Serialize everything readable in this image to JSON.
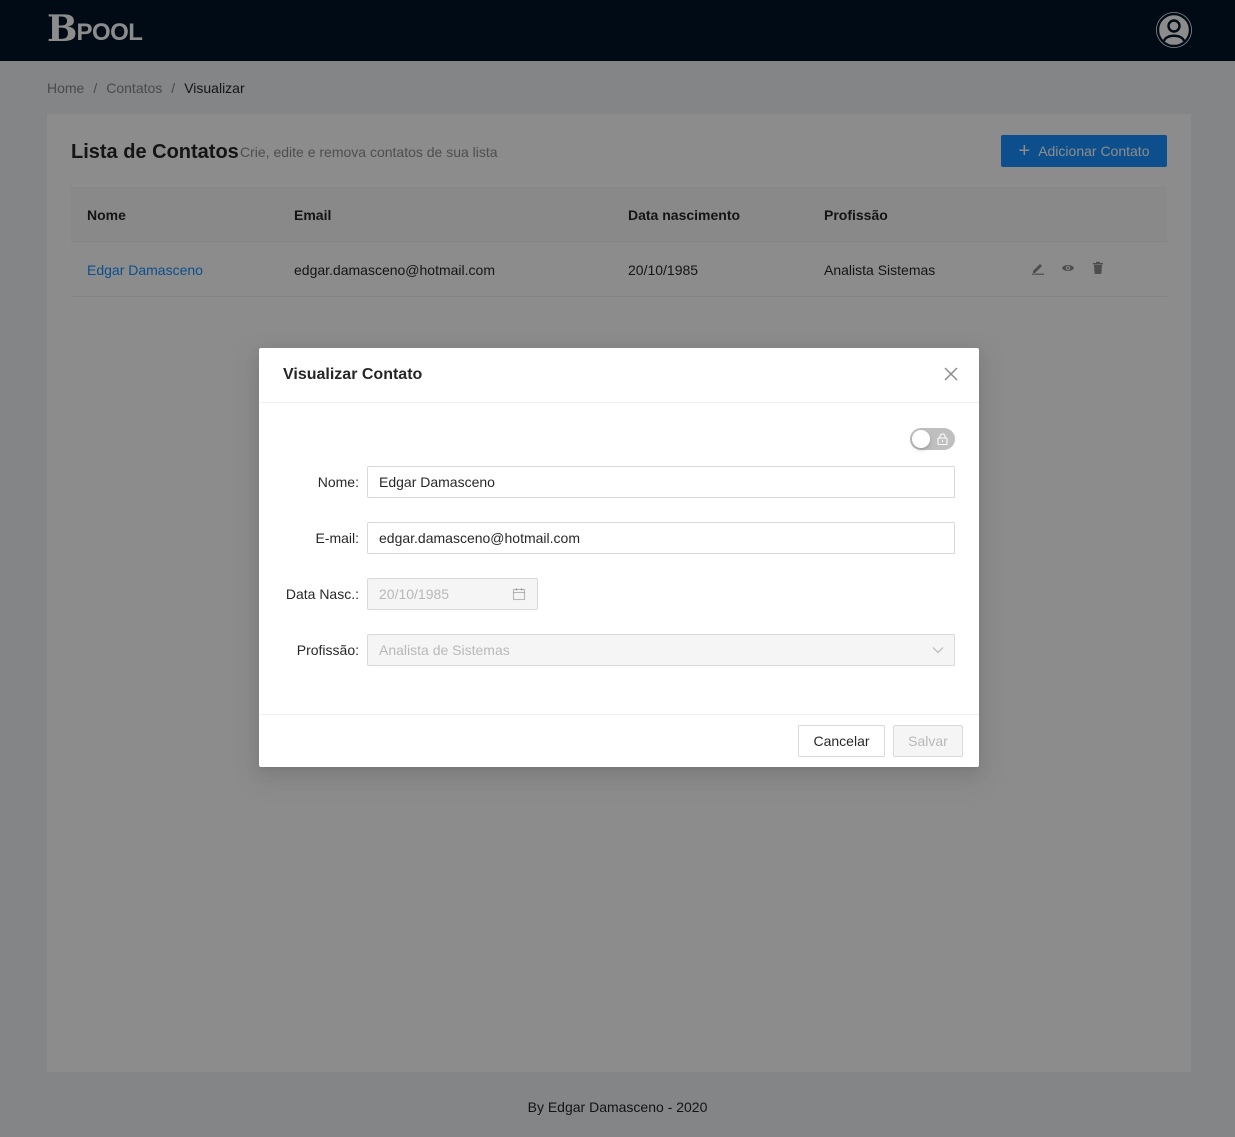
{
  "header": {
    "logo_b": "B",
    "logo_text": "POOL",
    "bg_color": "#001529"
  },
  "breadcrumb": {
    "items": [
      "Home",
      "Contatos",
      "Visualizar"
    ],
    "separator": "/"
  },
  "page": {
    "title": "Lista de Contatos",
    "subtitle": "Crie, edite e remova contatos de sua lista",
    "add_button_label": "Adicionar Contato",
    "accent_color": "#1890ff"
  },
  "table": {
    "columns": [
      "Nome",
      "Email",
      "Data nascimento",
      "Profissão"
    ],
    "rows": [
      {
        "nome": "Edgar Damasceno",
        "email": "edgar.damasceno@hotmail.com",
        "data_nascimento": "20/10/1985",
        "profissao": "Analista Sistemas",
        "actions": [
          "edit-icon",
          "eye-icon",
          "delete-icon"
        ]
      }
    ]
  },
  "modal": {
    "title": "Visualizar Contato",
    "edit_toggle": {
      "checked": false,
      "icon": "lock-icon"
    },
    "fields": {
      "nome": {
        "label": "Nome",
        "value": "Edgar Damasceno"
      },
      "email": {
        "label": "E-mail",
        "value": "edgar.damasceno@hotmail.com"
      },
      "data_nasc": {
        "label": "Data Nasc.",
        "value": "20/10/1985",
        "disabled": true,
        "icon": "calendar-icon"
      },
      "profissao": {
        "label": "Profissão",
        "value": "Analista de Sistemas",
        "disabled": true,
        "icon": "chevron-down-icon"
      }
    },
    "cancel_label": "Cancelar",
    "save_label": "Salvar"
  },
  "footer": {
    "text": "By Edgar Damasceno - 2020"
  }
}
